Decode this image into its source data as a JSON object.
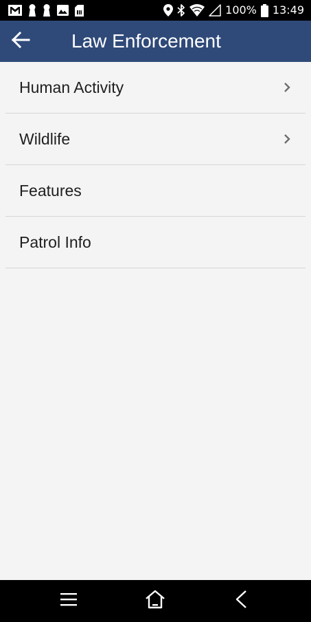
{
  "status_bar": {
    "battery_text": "100%",
    "time": "13:49",
    "left_icons": [
      "gmail-icon",
      "keyhole-icon",
      "keyhole-icon",
      "image-icon",
      "sim-card-icon"
    ],
    "right_icons": [
      "location-pin-icon",
      "bluetooth-icon",
      "wifi-icon",
      "signal-icon",
      "battery-icon"
    ]
  },
  "app_bar": {
    "title": "Law Enforcement",
    "back_icon": "back-arrow-icon",
    "color": "#2f4a79"
  },
  "menu": {
    "items": [
      {
        "label": "Human Activity",
        "has_submenu": true
      },
      {
        "label": "Wildlife",
        "has_submenu": true
      },
      {
        "label": "Features",
        "has_submenu": false
      },
      {
        "label": "Patrol Info",
        "has_submenu": false
      }
    ]
  },
  "nav_bar": {
    "buttons": [
      "menu-icon",
      "home-icon",
      "back-icon"
    ]
  }
}
